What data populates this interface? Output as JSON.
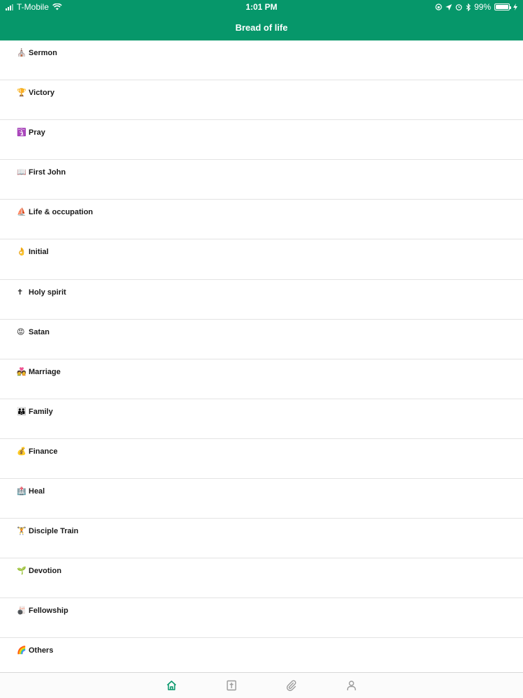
{
  "status_bar": {
    "carrier": "T-Mobile",
    "time": "1:01 PM",
    "battery_percent": "99%",
    "battery_level": 0.99,
    "icons": [
      "signal-icon",
      "wifi-icon",
      "orientation-lock-icon",
      "location-icon",
      "alarm-icon",
      "bluetooth-icon",
      "battery-icon",
      "charging-icon"
    ]
  },
  "header": {
    "title": "Bread of life"
  },
  "menu": {
    "items": [
      {
        "emoji": "⛪",
        "label": "Sermon"
      },
      {
        "emoji": "🏆",
        "label": "Victory"
      },
      {
        "emoji": "🛐",
        "label": "Pray"
      },
      {
        "emoji": "📖",
        "label": "First John"
      },
      {
        "emoji": "⛵",
        "label": "Life & occupation"
      },
      {
        "emoji": "👌",
        "label": "Initial"
      },
      {
        "emoji": "✝",
        "label": "Holy spirit"
      },
      {
        "emoji": "😡",
        "label": "Satan"
      },
      {
        "emoji": "💑",
        "label": "Marriage"
      },
      {
        "emoji": "👪",
        "label": "Family"
      },
      {
        "emoji": "💰",
        "label": "Finance"
      },
      {
        "emoji": "🏥",
        "label": "Heal"
      },
      {
        "emoji": "🏋",
        "label": "Disciple Train"
      },
      {
        "emoji": "🌱",
        "label": "Devotion"
      },
      {
        "emoji": "🎳",
        "label": "Fellowship"
      },
      {
        "emoji": "🌈",
        "label": "Others"
      }
    ]
  },
  "tab_bar": {
    "active_color": "#06976a",
    "inactive_color": "#9a9a9a",
    "tabs": [
      {
        "icon": "home-icon",
        "active": true
      },
      {
        "icon": "bible-cross-icon",
        "active": false
      },
      {
        "icon": "paperclip-icon",
        "active": false
      },
      {
        "icon": "person-icon",
        "active": false
      }
    ]
  }
}
